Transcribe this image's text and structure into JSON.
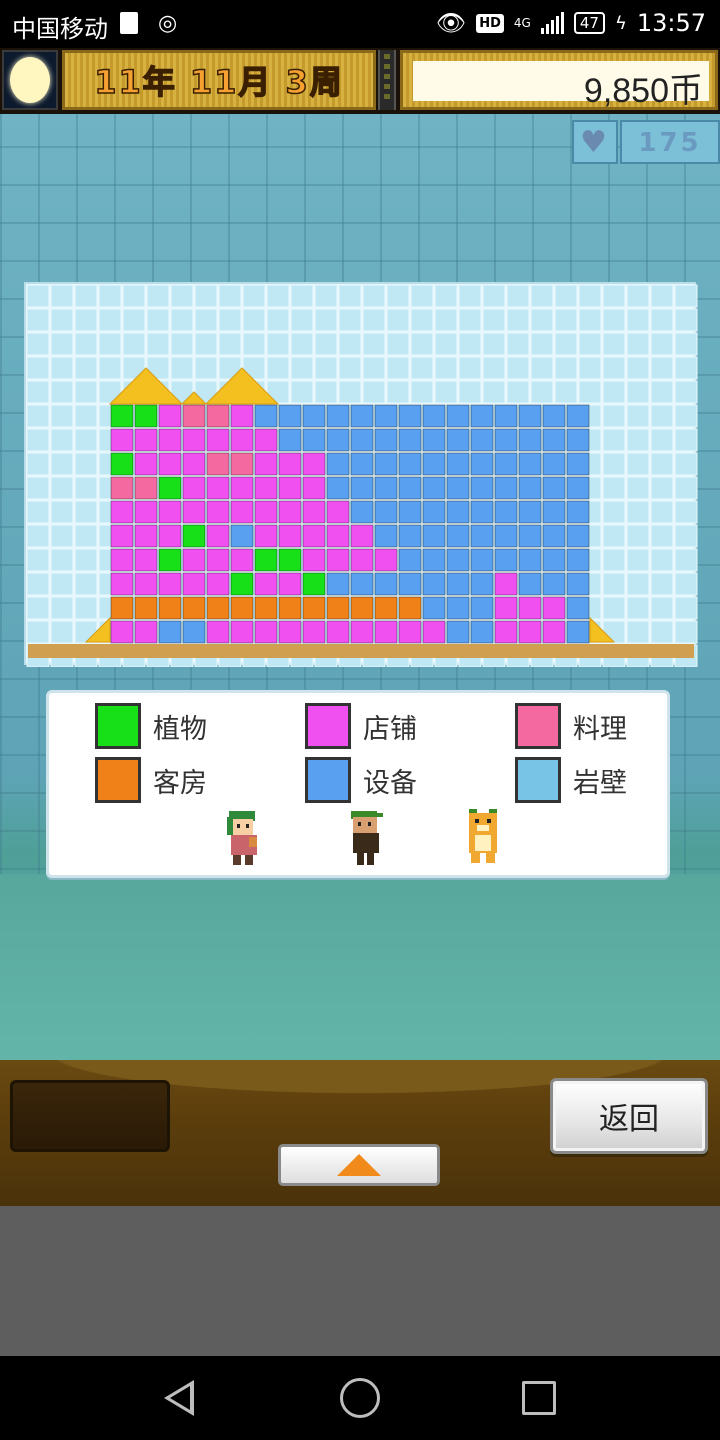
{
  "status_bar": {
    "carrier": "中国移动",
    "network": "4G",
    "hd": "HD",
    "battery": "47",
    "time": "13:57"
  },
  "header": {
    "date": "11年 11月 3周",
    "money": "9,850币"
  },
  "stats": {
    "count": "175"
  },
  "legend": [
    {
      "label": "植物",
      "color": "#18e018"
    },
    {
      "label": "店铺",
      "color": "#f050f0"
    },
    {
      "label": "料理",
      "color": "#f46aa0"
    },
    {
      "label": "客房",
      "color": "#f08018"
    },
    {
      "label": "设备",
      "color": "#5aa0f0"
    },
    {
      "label": "岩壁",
      "color": "#78c4e6"
    }
  ],
  "building_grid": [
    "GGSPPSEEEEEEEEEEEEEE",
    "SSSSSSSEEEEEEEEEEEEE",
    "GSSSPPSSSEEEEEEEEEEE",
    "PPGSSSSSSEEEEEEEEEEE",
    "SSSSSSSSSSEEEEEEEEEE",
    "SSSGSESSSSSEEEEEEEEE",
    "SSGSSSGGSSSSEEEEEEEE",
    "SSSSSGSSGEEEEEEESEEE",
    "OOOOOOOOOOOOOEEESSSE",
    "SSEESSSSSSSSSSEESSSE"
  ],
  "buttons": {
    "back": "返回"
  }
}
